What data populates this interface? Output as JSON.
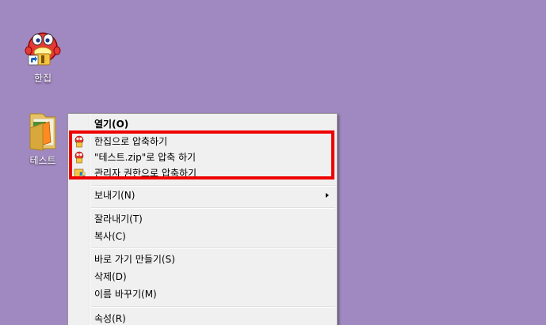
{
  "desktop": {
    "background_color": "#a088c0",
    "icons": [
      {
        "name": "hanzip",
        "label": "한집",
        "icon": "hanzip-mascot-shortcut-icon"
      },
      {
        "name": "folder",
        "label": "테스트",
        "icon": "folder-icon"
      }
    ]
  },
  "context_menu": {
    "open_label": "열기(O)",
    "compress_hanzip_label": "한집으로 압축하기",
    "compress_zip_label": "\"테스트.zip\"로 압축 하기",
    "compress_admin_label": "관리자 권한으로 압축하기",
    "send_to_label": "보내기(N)",
    "cut_label": "잘라내기(T)",
    "copy_label": "복사(C)",
    "shortcut_label": "바로 가기 만들기(S)",
    "delete_label": "삭제(D)",
    "rename_label": "이름 바꾸기(M)",
    "properties_label": "속성(R)"
  },
  "highlight_color": "#ee0000"
}
